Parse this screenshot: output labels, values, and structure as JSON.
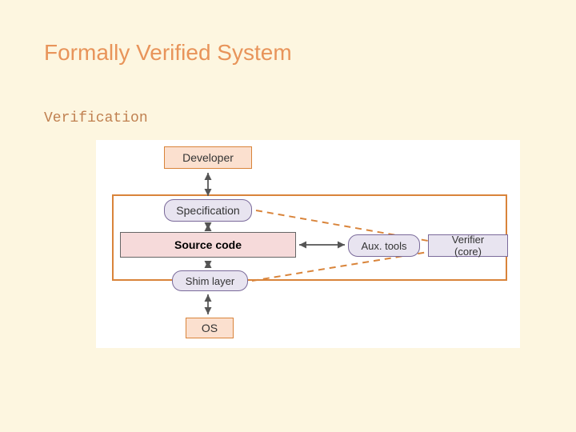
{
  "title": "Formally Verified System",
  "subtitle": "Verification",
  "diagram": {
    "developer": "Developer",
    "specification": "Specification",
    "source_code": "Source code",
    "shim_layer": "Shim layer",
    "os": "OS",
    "aux_tools": "Aux. tools",
    "verifier": "Verifier (core)"
  }
}
